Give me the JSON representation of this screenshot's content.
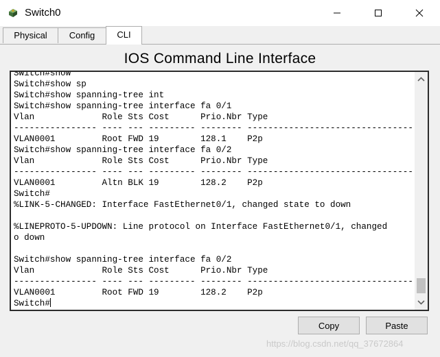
{
  "window": {
    "title": "Switch0"
  },
  "tabs": [
    {
      "label": "Physical"
    },
    {
      "label": "Config"
    },
    {
      "label": "CLI"
    }
  ],
  "panel": {
    "title": "IOS Command Line Interface"
  },
  "terminal": {
    "lines": [
      "Switch#show",
      "Switch#show sp",
      "Switch#show spanning-tree int",
      "Switch#show spanning-tree interface fa 0/1",
      "Vlan             Role Sts Cost      Prio.Nbr Type",
      "---------------- ---- --- --------- -------- --------------------------------",
      "VLAN0001         Root FWD 19        128.1    P2p",
      "Switch#show spanning-tree interface fa 0/2",
      "Vlan             Role Sts Cost      Prio.Nbr Type",
      "---------------- ---- --- --------- -------- --------------------------------",
      "VLAN0001         Altn BLK 19        128.2    P2p",
      "Switch#",
      "%LINK-5-CHANGED: Interface FastEthernet0/1, changed state to down",
      "",
      "%LINEPROTO-5-UPDOWN: Line protocol on Interface FastEthernet0/1, changed",
      "o down",
      "",
      "Switch#show spanning-tree interface fa 0/2",
      "Vlan             Role Sts Cost      Prio.Nbr Type",
      "---------------- ---- --- --------- -------- --------------------------------",
      "VLAN0001         Root FWD 19        128.2    P2p"
    ],
    "prompt": "Switch#"
  },
  "buttons": {
    "copy_label": "Copy",
    "paste_label": "Paste"
  },
  "watermark": "https://blog.csdn.net/qq_37672864",
  "colors": {
    "background": "#f0f0f0",
    "terminal_bg": "#ffffff",
    "terminal_border": "#2b2b2b"
  },
  "icons": {
    "app": "cisco-switch-icon",
    "minimize": "minimize-icon",
    "maximize": "maximize-icon",
    "close": "close-icon",
    "scroll_up": "chevron-up-icon",
    "scroll_down": "chevron-down-icon"
  }
}
